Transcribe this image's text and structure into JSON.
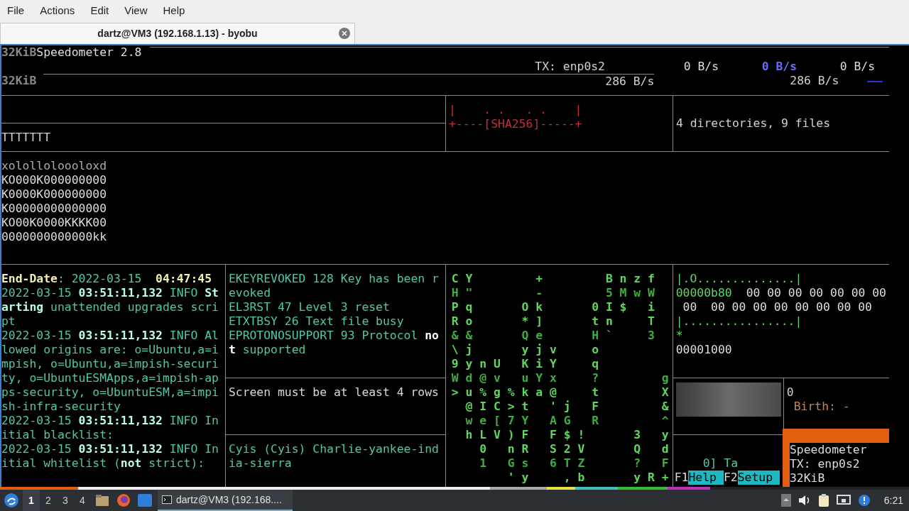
{
  "menu": [
    "File",
    "Actions",
    "Edit",
    "View",
    "Help"
  ],
  "tabs": [
    {
      "label": "dartz@VM3 (192.168.1.13) - byobu",
      "selected": true
    }
  ],
  "speedometer": {
    "scale_top": "32KiB",
    "title": "Speedometer 2.8",
    "interface": "TX: enp0s2",
    "readings": [
      {
        "text": "0 B/s",
        "highlight": false
      },
      {
        "text": "0 B/s",
        "highlight": true
      },
      {
        "text": "0 B/s",
        "highlight": false
      }
    ],
    "scale_bottom": "32KiB",
    "current": [
      "286 B/s",
      "286 B/s"
    ]
  },
  "tree_panel": {
    "text": "TTTTTTT"
  },
  "sha_panel": {
    "lines": [
      "|    . .   . .    |",
      "+----[SHA256]-----+"
    ]
  },
  "summary_panel": {
    "text": "4 directories, 9 files"
  },
  "art_lines": [
    "xololloloooloxd",
    "KO000K000000000",
    "K0000K000000000",
    "K00000000000000",
    "KO00K0000KKKK00",
    "0000000000000kk"
  ],
  "log_lines": [
    "**End-Date**: 2022-03-15  **04:47:45**",
    "2022-03-15 **03:51:11,132** INFO **Starting** unattended upgrades script",
    "2022-03-15 **03:51:11,132** INFO Allowed origins are: o=Ubuntu,a=impish, o=Ubuntu,a=impish-security, o=UbuntuESMApps,a=impish-apps-security, o=UbuntuESM,a=impish-infra-security",
    "2022-03-15 **03:51:11,132** INFO Initial blacklist:",
    "2022-03-15 **03:51:11,132** INFO Initial whitelist (**not** strict):"
  ],
  "errno_lines": [
    "EKEYREVOKED 128 Key has been revoked",
    "EL3RST 47 Level 3 reset",
    "ETXTBSY 26 Text file busy",
    "EPROTONOSUPPORT 93 Protocol **not** supported"
  ],
  "screen_message": "Screen must be at least 4 rows",
  "nato_line": "Cyis (Cyis) Charlie-yankee-india-sierra",
  "matrix_rows": [
    "C Y         +         B n z f",
    "H \"         -         5 M w W",
    "P q       O k       0 I $   i",
    "R o       * ]       t n     T",
    "& &       Q e       H `     3",
    "\\ j       y j v     o",
    "9 y n U   K i Y     q",
    "W d @ v   u Y x     ?         g",
    "> u % g % k a @     t         X",
    "  @ I C > t   ' j   F         &",
    "  w e [ 7 Y   A G   R         ^",
    "  h L V ) F   F $ !       3   y",
    "    0   n R   S 2 V       Q   d",
    "    1   G s   6 T Z       ?   F",
    "        ' y     , b       y R +"
  ],
  "hex_lines": [
    {
      "kind": "ascii",
      "text": "|.O..............|"
    },
    {
      "kind": "offset",
      "offset": "00000b80",
      "bytes": "00 00 00 00 00 00 00"
    },
    {
      "kind": "bytes",
      "text": " 00  00 00 00 00 00 00 00 00"
    },
    {
      "kind": "ascii",
      "text": "|................|"
    },
    {
      "kind": "mark",
      "text": "*"
    },
    {
      "kind": "plain",
      "text": "00001000"
    }
  ],
  "stat_panel": {
    "size": "0",
    "birth": "Birth: -"
  },
  "prompt_fragment": "0] Ta",
  "fkeys": [
    {
      "key": "F1",
      "label": "Help"
    },
    {
      "key": "F2",
      "label": "Setup"
    }
  ],
  "popup": {
    "lines": [
      "Speedometer",
      "TX: enp0s2",
      "32KiB"
    ]
  },
  "taskbar": {
    "workspaces": [
      {
        "label": "1",
        "selected": true
      },
      {
        "label": "2",
        "selected": false
      },
      {
        "label": "3",
        "selected": false
      },
      {
        "label": "4",
        "selected": false
      }
    ],
    "task": "dartz@VM3 (192.168....",
    "clock": "6:21"
  }
}
